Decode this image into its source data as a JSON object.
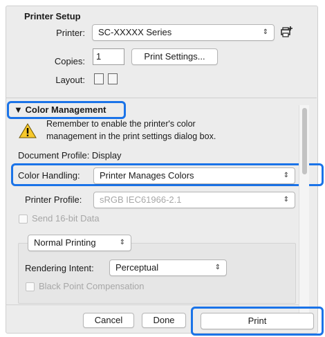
{
  "printer_setup": {
    "heading": "Printer Setup",
    "printer_label": "Printer:",
    "printer_value": "SC-XXXXX Series",
    "copies_label": "Copies:",
    "copies_value": "1",
    "print_settings_button": "Print Settings...",
    "layout_label": "Layout:"
  },
  "color_management": {
    "heading": "Color Management",
    "warning_line1": "Remember to enable the printer's color",
    "warning_line2": "management in the print settings dialog box.",
    "document_profile": "Document Profile: Display",
    "color_handling_label": "Color Handling:",
    "color_handling_value": "Printer Manages Colors",
    "printer_profile_label": "Printer Profile:",
    "printer_profile_value": "sRGB IEC61966-2.1",
    "send_16bit_label": "Send 16-bit Data",
    "printing_mode_value": "Normal Printing",
    "rendering_intent_label": "Rendering Intent:",
    "rendering_intent_value": "Perceptual",
    "black_point_label": "Black Point Compensation"
  },
  "footer": {
    "cancel": "Cancel",
    "done": "Done",
    "print": "Print"
  },
  "highlight_color": "#1a73e8"
}
